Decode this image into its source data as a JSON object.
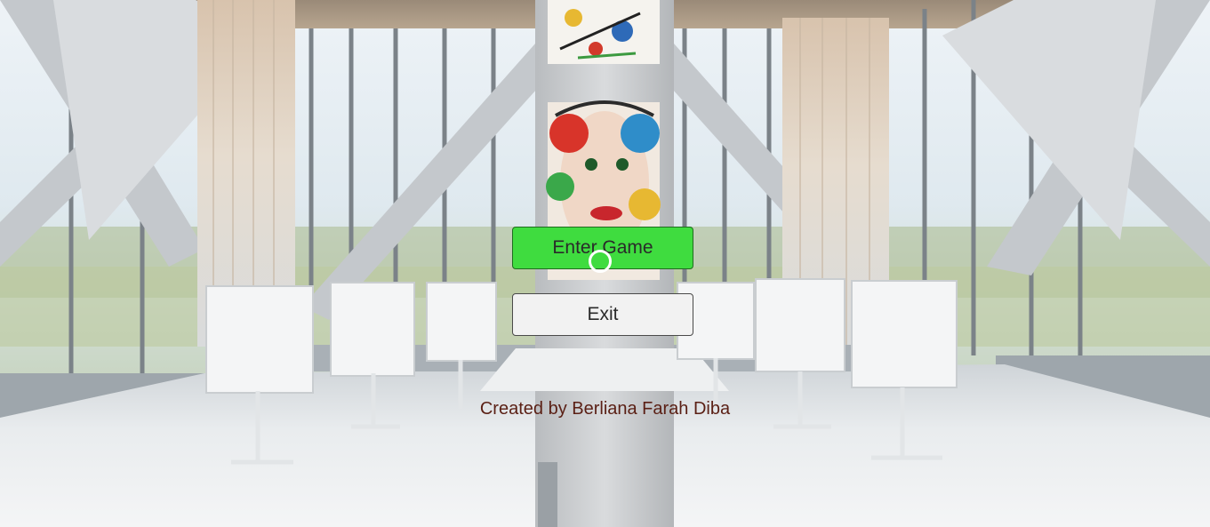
{
  "menu": {
    "enter_label": "Enter Game",
    "exit_label": "Exit"
  },
  "credit": {
    "text": "Created by Berliana Farah Diba"
  },
  "colors": {
    "enter_button": "#3fdc3f",
    "exit_button": "#f2f2f2",
    "credit_text": "#5a1f14"
  },
  "icons": {
    "cursor": "circle-cursor-icon"
  }
}
